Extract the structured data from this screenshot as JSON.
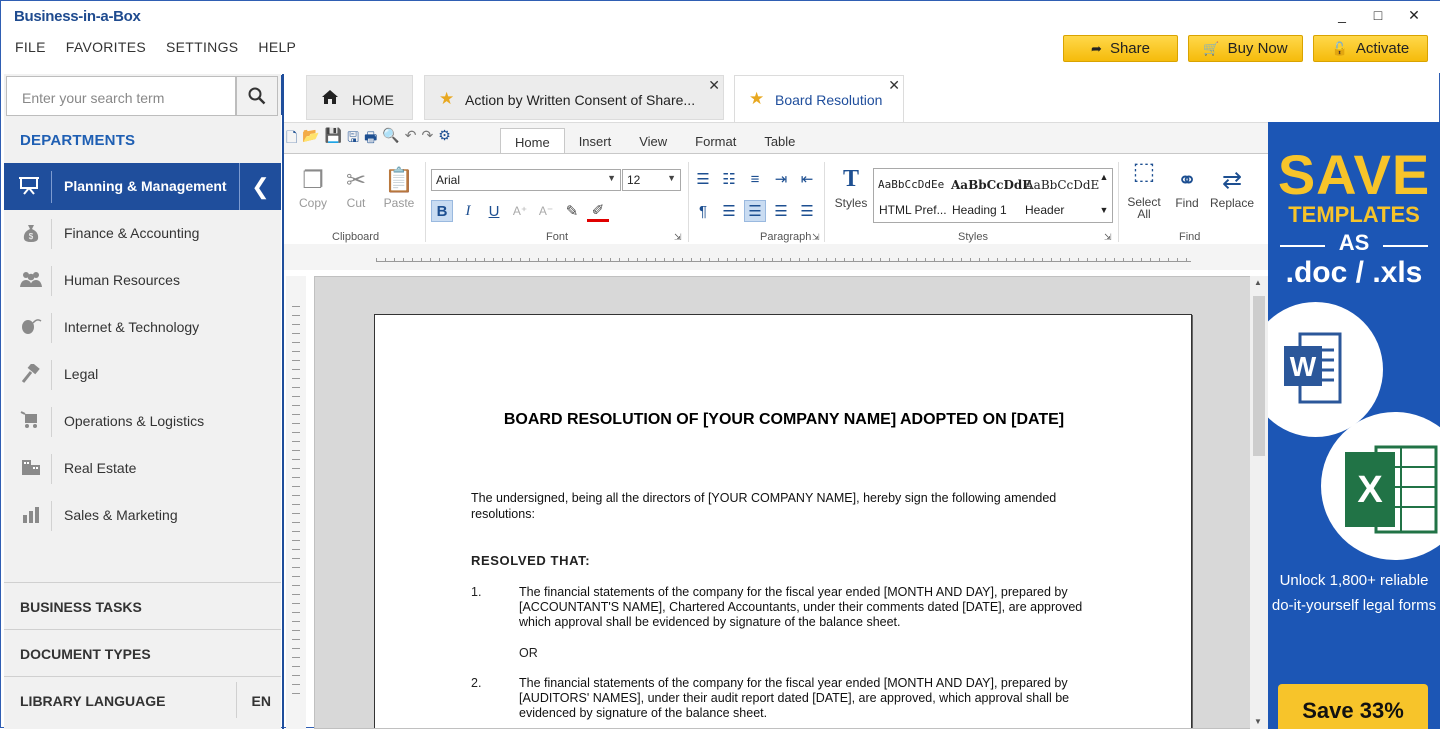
{
  "app": {
    "logo": "Business-in-a-Box",
    "menu": [
      "FILE",
      "FAVORITES",
      "SETTINGS",
      "HELP"
    ],
    "window_controls": [
      "_",
      "□",
      "✕"
    ],
    "top_buttons": [
      {
        "label": "Share",
        "icon": "share-icon"
      },
      {
        "label": "Buy Now",
        "icon": "cart-icon"
      },
      {
        "label": "Activate",
        "icon": "unlock-icon"
      }
    ]
  },
  "sidebar": {
    "search_placeholder": "Enter your search term",
    "departments_heading": "DEPARTMENTS",
    "active_department": "Planning & Management",
    "departments": [
      {
        "label": "Finance & Accounting",
        "icon": "money-bag-icon"
      },
      {
        "label": "Human Resources",
        "icon": "people-icon"
      },
      {
        "label": "Internet & Technology",
        "icon": "mouse-icon"
      },
      {
        "label": "Legal",
        "icon": "gavel-icon"
      },
      {
        "label": "Operations & Logistics",
        "icon": "cart-icon"
      },
      {
        "label": "Real Estate",
        "icon": "building-icon"
      },
      {
        "label": "Sales & Marketing",
        "icon": "bar-chart-icon"
      }
    ],
    "footer": {
      "business_tasks": "BUSINESS TASKS",
      "document_types": "DOCUMENT TYPES",
      "library_language": "LIBRARY LANGUAGE",
      "language_code": "EN"
    }
  },
  "tabs": [
    {
      "label": "HOME",
      "icon": "home-icon"
    },
    {
      "label": "Action by Written Consent of Share...",
      "icon": "star-icon"
    },
    {
      "label": "Board Resolution",
      "icon": "star-icon"
    }
  ],
  "ribbon": {
    "tabs": [
      "Home",
      "Insert",
      "View",
      "Format",
      "Table"
    ],
    "clipboard": {
      "copy": "Copy",
      "cut": "Cut",
      "paste": "Paste",
      "group": "Clipboard"
    },
    "font": {
      "family": "Arial",
      "size": "12",
      "group": "Font"
    },
    "paragraph": {
      "group": "Paragraph"
    },
    "styles": {
      "button": "Styles",
      "group": "Styles",
      "samples": [
        {
          "sample": "AaBbCcDdEe",
          "name": "HTML Pref..."
        },
        {
          "sample": "AaBbCcDdE",
          "name": "Heading 1"
        },
        {
          "sample": "AaBbCcDdE",
          "name": "Header"
        }
      ]
    },
    "find": {
      "select_all": "Select All",
      "find": "Find",
      "replace": "Replace",
      "group": "Find"
    }
  },
  "document": {
    "title": "BOARD RESOLUTION OF [YOUR COMPANY NAME] ADOPTED ON [DATE]",
    "intro": "The undersigned, being all the directors of [YOUR COMPANY NAME], hereby sign the following amended resolutions:",
    "resolved": "RESOLVED THAT:",
    "items": [
      {
        "num": "1.",
        "text": "The financial statements of the company for the fiscal year ended [MONTH AND DAY], prepared by [ACCOUNTANT'S NAME], Chartered Accountants, under their comments dated [DATE], are approved which approval shall be evidenced by signature of the balance sheet."
      },
      {
        "num": "2.",
        "text": "The financial statements of the company for the fiscal year ended [MONTH AND DAY], prepared by [AUDITORS' NAMES], under their audit report dated [DATE], are approved, which approval shall be evidenced by signature of the balance sheet."
      }
    ],
    "or": "OR"
  },
  "ad": {
    "headline": "SAVE",
    "line2": "TEMPLATES",
    "line3": "AS",
    "line4": ".doc / .xls",
    "word_letter": "W",
    "excel_letter": "X",
    "body": "Unlock 1,800+ reliable do-it-yourself legal forms",
    "cta": "Save 33%"
  },
  "colors": {
    "accent_blue": "#1f4e9c",
    "ad_blue": "#1c56b5",
    "ad_yellow": "#f7c42a",
    "button_yellow": "#f5bb0b"
  }
}
